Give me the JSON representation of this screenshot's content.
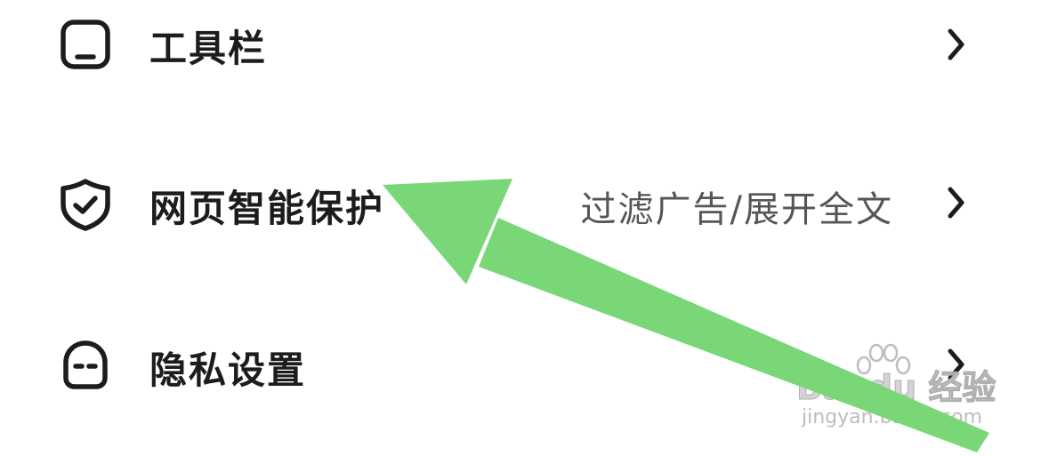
{
  "settings_list": {
    "items": [
      {
        "label": "工具栏",
        "value": "",
        "icon": "toolbar-icon"
      },
      {
        "label": "网页智能保护",
        "value": "过滤广告/展开全文",
        "icon": "shield-check-icon"
      },
      {
        "label": "隐私设置",
        "value": "",
        "icon": "privacy-face-icon"
      }
    ],
    "chevron": "›"
  },
  "annotation": {
    "arrow_color": "#79D778"
  },
  "watermark": {
    "brand": "Bai du 经验",
    "url": "jingyan.baidu.com"
  }
}
